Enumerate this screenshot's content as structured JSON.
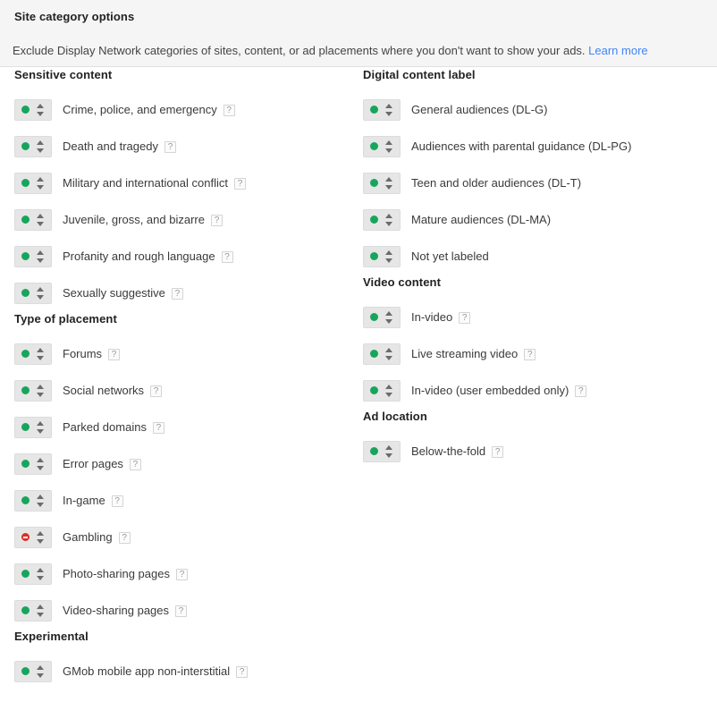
{
  "header": {
    "title": "Site category options",
    "description": "Exclude Display Network categories of sites, content, or ad placements where you don't want to show your ads.",
    "learn_more": "Learn more",
    "link_color": "#4285f4",
    "band_color": "#f5f5f5"
  },
  "status_icons": {
    "included": "green-dot-icon",
    "excluded": "red-blocked-icon",
    "stepper": "up-down-chevron-icon",
    "help": "question-mark-icon",
    "included_color": "#17a55c",
    "excluded_color": "#d93025"
  },
  "columns": {
    "left": [
      {
        "heading": "Sensitive content",
        "items": [
          {
            "label": "Crime, police, and emergency",
            "status": "included",
            "help": "?"
          },
          {
            "label": "Death and tragedy",
            "status": "included",
            "help": "?"
          },
          {
            "label": "Military and international conflict",
            "status": "included",
            "help": "?"
          },
          {
            "label": "Juvenile, gross, and bizarre",
            "status": "included",
            "help": "?"
          },
          {
            "label": "Profanity and rough language",
            "status": "included",
            "help": "?"
          },
          {
            "label": "Sexually suggestive",
            "status": "included",
            "help": "?"
          }
        ]
      },
      {
        "heading": "Type of placement",
        "items": [
          {
            "label": "Forums",
            "status": "included",
            "help": "?"
          },
          {
            "label": "Social networks",
            "status": "included",
            "help": "?"
          },
          {
            "label": "Parked domains",
            "status": "included",
            "help": "?"
          },
          {
            "label": "Error pages",
            "status": "included",
            "help": "?"
          },
          {
            "label": "In-game",
            "status": "included",
            "help": "?"
          },
          {
            "label": "Gambling",
            "status": "excluded",
            "help": "?"
          },
          {
            "label": "Photo-sharing pages",
            "status": "included",
            "help": "?"
          },
          {
            "label": "Video-sharing pages",
            "status": "included",
            "help": "?"
          }
        ]
      },
      {
        "heading": "Experimental",
        "items": [
          {
            "label": "GMob mobile app non-interstitial",
            "status": "included",
            "help": "?"
          }
        ]
      }
    ],
    "right": [
      {
        "heading": "Digital content label",
        "items": [
          {
            "label": "General audiences (DL-G)",
            "status": "included",
            "help": ""
          },
          {
            "label": "Audiences with parental guidance (DL-PG)",
            "status": "included",
            "help": ""
          },
          {
            "label": "Teen and older audiences (DL-T)",
            "status": "included",
            "help": ""
          },
          {
            "label": "Mature audiences (DL-MA)",
            "status": "included",
            "help": ""
          },
          {
            "label": "Not yet labeled",
            "status": "included",
            "help": ""
          }
        ]
      },
      {
        "heading": "Video content",
        "items": [
          {
            "label": "In-video",
            "status": "included",
            "help": "?"
          },
          {
            "label": "Live streaming video",
            "status": "included",
            "help": "?"
          },
          {
            "label": "In-video (user embedded only)",
            "status": "included",
            "help": "?"
          }
        ]
      },
      {
        "heading": "Ad location",
        "items": [
          {
            "label": "Below-the-fold",
            "status": "included",
            "help": "?"
          }
        ]
      }
    ]
  }
}
